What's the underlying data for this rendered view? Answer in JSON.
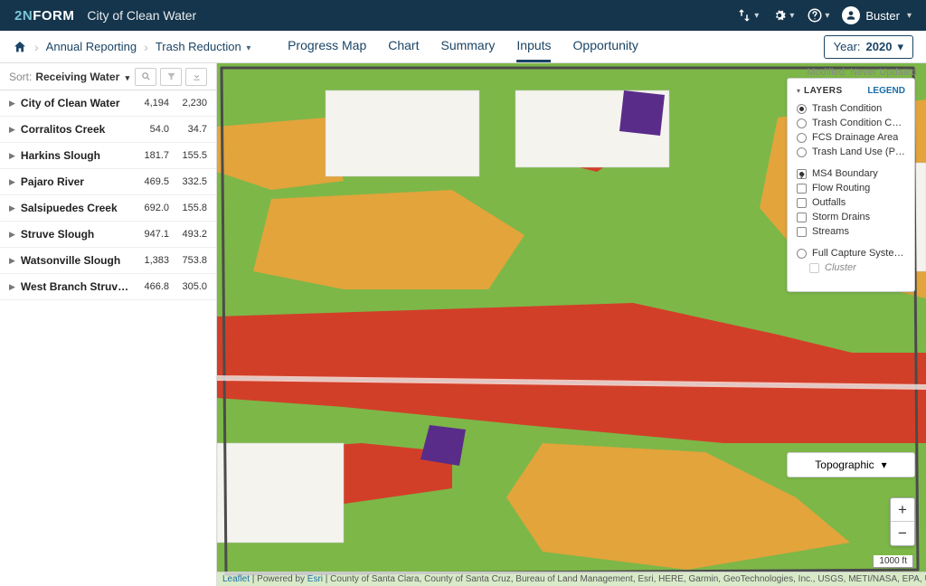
{
  "brand": {
    "prefix": "2N",
    "name": "FORM"
  },
  "app_title": "City of Clean Water",
  "user_name": "Buster",
  "breadcrumbs": {
    "b1": "Annual Reporting",
    "b2": "Trash Reduction"
  },
  "tabs": {
    "progress_map": "Progress Map",
    "chart": "Chart",
    "summary": "Summary",
    "inputs": "Inputs",
    "opportunity": "Opportunity"
  },
  "year_picker": {
    "label": "Year:",
    "value": "2020"
  },
  "sort": {
    "label": "Sort:",
    "value": "Receiving Water"
  },
  "sidebar_rows": [
    {
      "name": "City of Clean Water",
      "c1": "4,194",
      "c2": "2,230"
    },
    {
      "name": "Corralitos Creek",
      "c1": "54.0",
      "c2": "34.7"
    },
    {
      "name": "Harkins Slough",
      "c1": "181.7",
      "c2": "155.5"
    },
    {
      "name": "Pajaro River",
      "c1": "469.5",
      "c2": "332.5"
    },
    {
      "name": "Salsipuedes Creek",
      "c1": "692.0",
      "c2": "155.8"
    },
    {
      "name": "Struve Slough",
      "c1": "947.1",
      "c2": "493.2"
    },
    {
      "name": "Watsonville Slough",
      "c1": "1,383",
      "c2": "753.8"
    },
    {
      "name": "West Branch Struve Slo...",
      "c1": "466.8",
      "c2": "305.0"
    }
  ],
  "modified_label": "Modified: Never Updated",
  "layers_panel": {
    "title": "LAYERS",
    "legend_label": "LEGEND",
    "radio_group": [
      {
        "label": "Trash Condition",
        "checked": true
      },
      {
        "label": "Trash Condition Certainty",
        "checked": false
      },
      {
        "label": "FCS Drainage Area",
        "checked": false
      },
      {
        "label": "Trash Land Use (PLU)",
        "checked": false
      }
    ],
    "check_group": [
      {
        "label": "MS4 Boundary",
        "checked": true
      },
      {
        "label": "Flow Routing",
        "checked": false
      },
      {
        "label": "Outfalls",
        "checked": false
      },
      {
        "label": "Storm Drains",
        "checked": false
      },
      {
        "label": "Streams",
        "checked": false
      }
    ],
    "fcs_group": {
      "parent": {
        "label": "Full Capture Systems (FCS)",
        "checked": false
      },
      "child": {
        "label": "Cluster",
        "checked": false
      }
    }
  },
  "basemap": "Topographic",
  "zoom": {
    "in": "+",
    "out": "−"
  },
  "scalebar": "1000 ft",
  "attribution": {
    "leaflet": "Leaflet",
    "poweredby": " | Powered by ",
    "esri": "Esri",
    "rest": " | County of Santa Clara, County of Santa Cruz, Bureau of Land Management, Esri, HERE, Garmin, GeoTechnologies, Inc., USGS, METI/NASA, EPA, USDA"
  },
  "map_colors": {
    "green": "#7db748",
    "yellow": "#e2a43b",
    "red": "#d23f29",
    "purple": "#5a2c8a",
    "streets": "#f4f3ee",
    "boundary": "#4b4b4b"
  }
}
